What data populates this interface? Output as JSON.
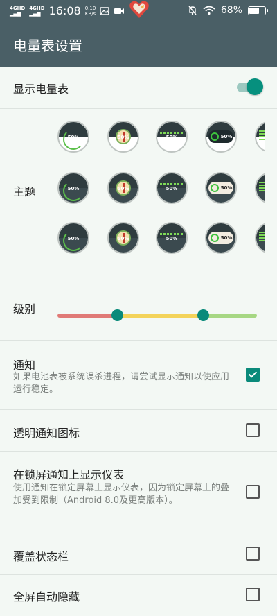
{
  "status_bar": {
    "network_1": "4GHD",
    "network_2": "4GHD",
    "time": "16:08",
    "speed_value": "0.10",
    "speed_unit": "KB/s",
    "battery": "68%",
    "icons": [
      "image-icon",
      "video-icon",
      "mute-icon",
      "wifi-icon",
      "battery-icon"
    ]
  },
  "app_bar": {
    "title": "电量表设置"
  },
  "show_meter": {
    "label": "显示电量表",
    "enabled": true
  },
  "theme": {
    "label": "主题",
    "gauge_text": "50%",
    "rows": [
      [
        "theme-arc-white",
        "theme-needle-white",
        "theme-bar-white",
        "theme-ring-white",
        "theme-grid-white"
      ],
      [
        "theme-arc-dark",
        "theme-needle-dark",
        "theme-bar-dark",
        "theme-ring-dark",
        "theme-grid-dark"
      ],
      [
        "theme-arc-slate",
        "theme-needle-slate",
        "theme-bar-slate",
        "theme-ring-slate",
        "theme-grid-slate"
      ]
    ]
  },
  "level": {
    "label": "级别",
    "low_threshold": 0.3,
    "high_threshold": 0.73,
    "colors": {
      "low": "#e07a76",
      "mid": "#f3d35a",
      "high": "#a6d783",
      "thumb": "#0a8a7a"
    }
  },
  "notification": {
    "label": "通知",
    "description": "如果电池表被系统误杀进程，请尝试显示通知以使应用运行稳定。",
    "checked": true
  },
  "transparent_icon": {
    "label": "透明通知图标",
    "checked": false
  },
  "lockscreen": {
    "label": "在锁屏通知上显示仪表",
    "description": "使用通知在锁定屏幕上显示仪表，因为锁定屏幕上的叠加受到限制（Android 8.0及更高版本）。",
    "checked": false
  },
  "cover_status_bar": {
    "label": "覆盖状态栏",
    "checked": false
  },
  "fullscreen_hide": {
    "label": "全屏自动隐藏",
    "checked": false
  },
  "accent_color": "#0a8a7a",
  "header_color": "#4a5f66"
}
